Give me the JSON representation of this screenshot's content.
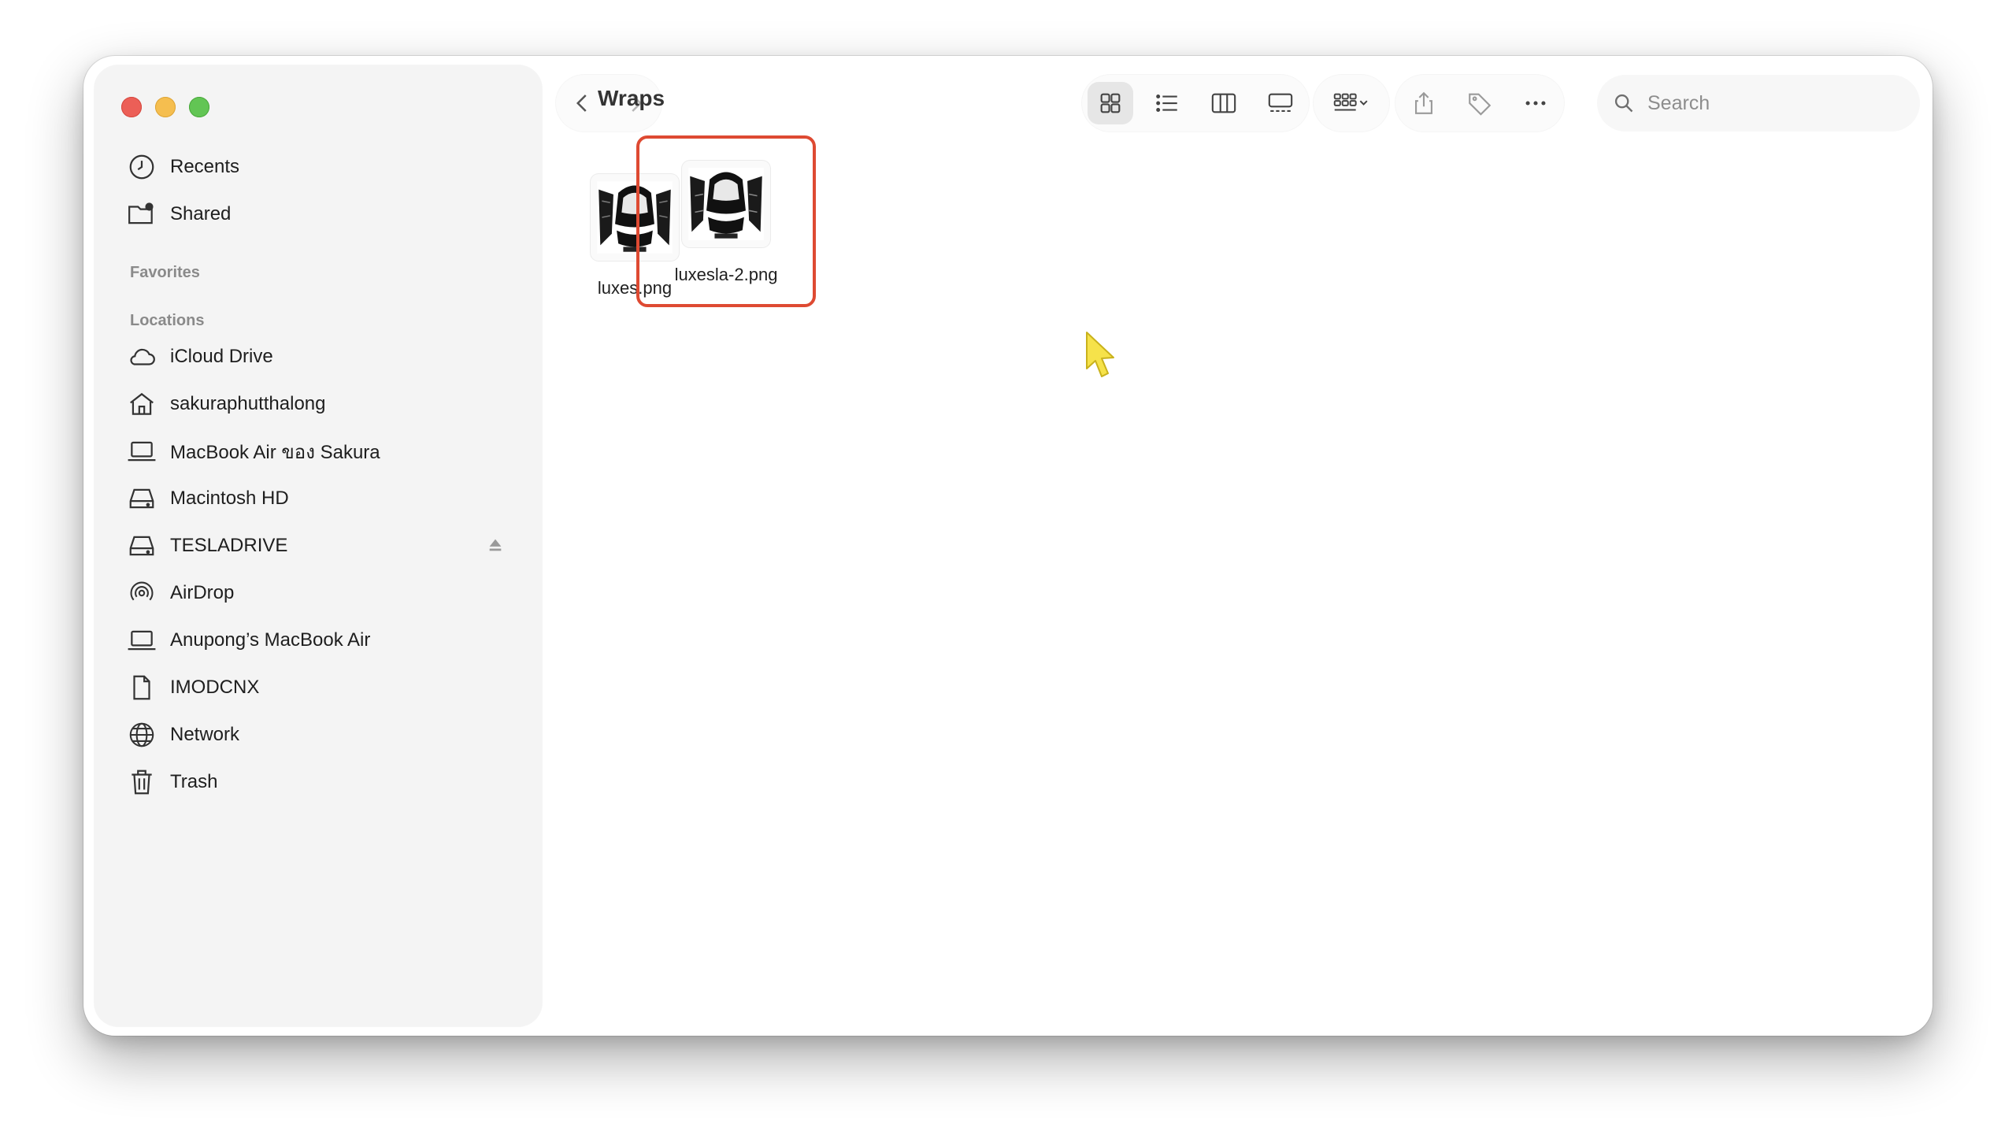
{
  "window": {
    "title": "Wraps"
  },
  "sidebar": {
    "top_items": [
      {
        "label": "Recents",
        "icon": "clock-icon"
      },
      {
        "label": "Shared",
        "icon": "shared-folder-icon"
      }
    ],
    "favorites_header": "Favorites",
    "locations_header": "Locations",
    "locations": [
      {
        "label": "iCloud Drive",
        "icon": "cloud-icon"
      },
      {
        "label": "sakuraphutthalong",
        "icon": "home-icon"
      },
      {
        "label": "MacBook Air ของ Sakura",
        "icon": "laptop-icon"
      },
      {
        "label": "Macintosh HD",
        "icon": "drive-icon"
      },
      {
        "label": "TESLADRIVE",
        "icon": "drive-icon",
        "ejectable": true
      },
      {
        "label": "AirDrop",
        "icon": "airdrop-icon"
      },
      {
        "label": "Anupong’s MacBook Air",
        "icon": "laptop-icon"
      },
      {
        "label": "IMODCNX",
        "icon": "document-icon"
      },
      {
        "label": "Network",
        "icon": "globe-icon"
      },
      {
        "label": "Trash",
        "icon": "trash-icon"
      }
    ]
  },
  "toolbar": {
    "view_modes": [
      "icon-view",
      "list-view",
      "column-view",
      "gallery-view"
    ],
    "active_view": "icon-view",
    "search_placeholder": "Search"
  },
  "files": [
    {
      "name": "luxes.png",
      "selected": false
    },
    {
      "name": "luxesla-2.png",
      "selected": true
    }
  ],
  "colors": {
    "selection_border": "#de4a32",
    "close": "#ec5f57",
    "minimize": "#f5be4f",
    "zoom": "#62c554",
    "cursor": "#f6e24a"
  }
}
